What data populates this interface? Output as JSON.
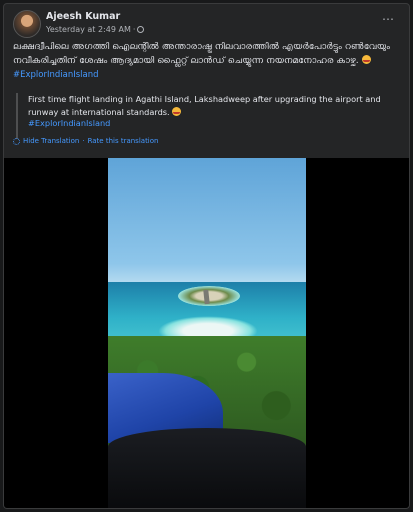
{
  "post": {
    "author": "Ajeesh Kumar",
    "timestamp": "Yesterday at 2:49 AM",
    "separator": "·",
    "more_icon": "⋯",
    "caption": "ലക്ഷദ്വീപിലെ അഗത്തി ഐലന്റിൽ അന്താരാഷ്ട്ര നിലവാരത്തിൽ എയർപോർട്ടും റൺവേയും നവീകരിച്ചതിന് ശേഷം ആദ്യമായി ഫ്ലൈറ്റ് ലാൻഡ് ചെയ്യുന്ന നയനമനോഹര കാഴ്ച.",
    "hashtag": "#ExplorIndianIsland",
    "translation": {
      "text": "First time flight landing in Agathi Island, Lakshadweep after upgrading the airport and runway at international standards.",
      "hashtag": "#ExplorIndianIsland",
      "hide_label": "Hide Translation",
      "dot": "·",
      "rate_label": "Rate this translation"
    }
  },
  "icons": [
    "avatar",
    "globe-icon",
    "more-icon",
    "emoji-icon",
    "settings-icon"
  ],
  "colors": {
    "background": "#18191a",
    "card": "#242526",
    "link": "#4599ff",
    "text": "#e4e6eb",
    "muted": "#b0b3b8"
  }
}
